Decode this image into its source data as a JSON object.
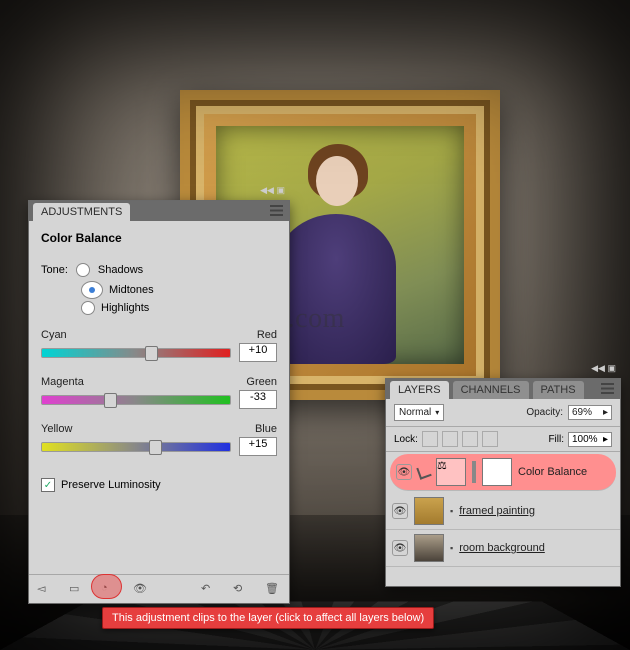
{
  "watermark": "www.psd    ude.com",
  "adjustments": {
    "tab": "ADJUSTMENTS",
    "title": "Color Balance",
    "tone_label": "Tone:",
    "tones": {
      "shadows": "Shadows",
      "midtones": "Midtones",
      "highlights": "Highlights"
    },
    "sliders": {
      "cyan": "Cyan",
      "red": "Red",
      "cyan_red_val": "+10",
      "magenta": "Magenta",
      "green": "Green",
      "mag_green_val": "-33",
      "yellow": "Yellow",
      "blue": "Blue",
      "yel_blue_val": "+15"
    },
    "preserve": "Preserve Luminosity"
  },
  "layers_panel": {
    "tabs": {
      "layers": "LAYERS",
      "channels": "CHANNELS",
      "paths": "PATHS"
    },
    "blend": "Normal",
    "opacity_label": "Opacity:",
    "opacity_value": "69%",
    "lock_label": "Lock:",
    "fill_label": "Fill:",
    "fill_value": "100%",
    "layers": [
      {
        "name": "Color Balance"
      },
      {
        "name": "framed painting"
      },
      {
        "name": "room background"
      }
    ]
  },
  "tooltip": "This adjustment clips to the layer (click to affect all layers below)"
}
